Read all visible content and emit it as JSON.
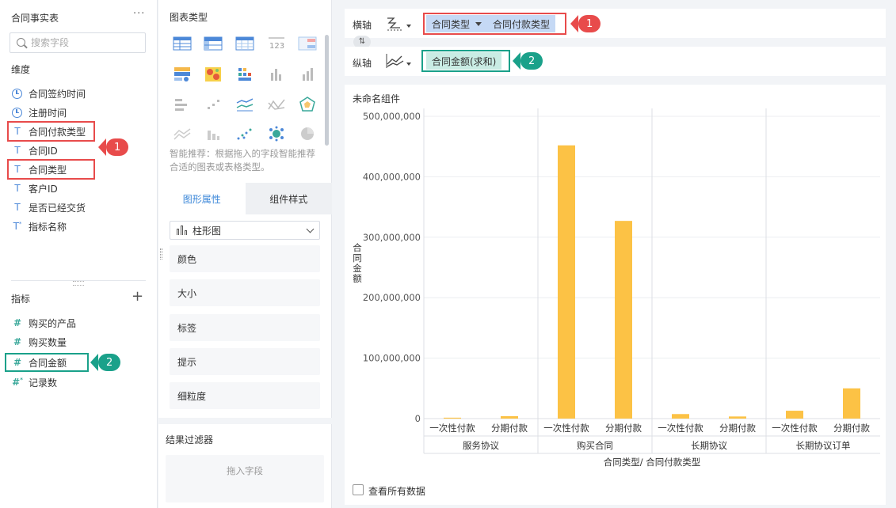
{
  "left_panel": {
    "dataset_title": "合同事实表",
    "more_label": "···",
    "search_placeholder": "搜索字段",
    "dimension_section": "维度",
    "dimensions": [
      {
        "icon": "clock-icon",
        "label": "合同签约时间"
      },
      {
        "icon": "clock-icon",
        "label": "注册时间"
      },
      {
        "icon": "text-type-icon",
        "label": "合同付款类型"
      },
      {
        "icon": "text-type-icon",
        "label": "合同ID"
      },
      {
        "icon": "text-type-icon",
        "label": "合同类型"
      },
      {
        "icon": "text-type-icon",
        "label": "客户ID"
      },
      {
        "icon": "text-type-icon",
        "label": "是否已经交货"
      },
      {
        "icon": "text-type-icon",
        "label": "指标名称"
      }
    ],
    "measure_section": "指标",
    "measures": [
      {
        "icon": "hash-icon",
        "label": "购买的产品"
      },
      {
        "icon": "hash-icon",
        "label": "购买数量"
      },
      {
        "icon": "hash-icon",
        "label": "合同金额"
      },
      {
        "icon": "hash-icon",
        "label": "记录数"
      }
    ]
  },
  "callouts": {
    "one": "1",
    "two": "2"
  },
  "chart_type_panel": {
    "title": "图表类型",
    "hint": "智能推荐：根据拖入的字段智能推荐合适的图表或表格类型。",
    "tabs": [
      "图形属性",
      "组件样式"
    ],
    "chart_select": "柱形图",
    "properties": [
      "颜色",
      "大小",
      "标签",
      "提示",
      "细粒度"
    ],
    "filter_title": "结果过滤器",
    "filter_drop": "拖入字段"
  },
  "x_axis": {
    "label": "横轴",
    "pills": [
      "合同类型",
      "合同付款类型"
    ]
  },
  "y_axis": {
    "label": "纵轴",
    "pills": [
      "合同金额(求和)"
    ]
  },
  "widget": {
    "title": "未命名组件",
    "show_all_data": "查看所有数据"
  },
  "colors": {
    "accent_blue": "#3a86d8",
    "highlight_red": "#e84b4b",
    "highlight_teal": "#1aa18a",
    "bar": "#fcc245"
  },
  "chart_data": {
    "type": "bar",
    "ylabel": "合同金额",
    "xlabel": "合同类型/ 合同付款类型",
    "ylim": [
      0,
      500000000
    ],
    "yticks": [
      0,
      100000000,
      200000000,
      300000000,
      400000000,
      500000000
    ],
    "ytick_labels": [
      "0",
      "100,000,000",
      "200,000,000",
      "300,000,000",
      "400,000,000",
      "500,000,000"
    ],
    "grid": true,
    "groups": [
      {
        "name": "服务协议",
        "categories": [
          "一次性付款",
          "分期付款"
        ],
        "values": [
          1500000,
          4000000
        ]
      },
      {
        "name": "购买合同",
        "categories": [
          "一次性付款",
          "分期付款"
        ],
        "values": [
          452000000,
          327000000
        ]
      },
      {
        "name": "长期协议",
        "categories": [
          "一次性付款",
          "分期付款"
        ],
        "values": [
          7500000,
          3500000
        ]
      },
      {
        "name": "长期协议订单",
        "categories": [
          "一次性付款",
          "分期付款"
        ],
        "values": [
          13000000,
          50000000
        ]
      }
    ]
  }
}
